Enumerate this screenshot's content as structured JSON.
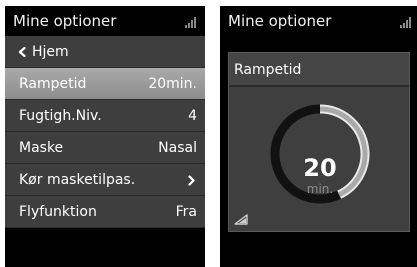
{
  "left_screen": {
    "title": "Mine optioner",
    "menu": [
      {
        "label": "Hjem",
        "value": "",
        "icon": "back-arrow-icon"
      },
      {
        "label": "Rampetid",
        "value": "20min.",
        "selected": true
      },
      {
        "label": "Fugtigh.Niv.",
        "value": "4"
      },
      {
        "label": "Maske",
        "value": "Nasal"
      },
      {
        "label": "Kør masketilpas.",
        "value": "",
        "icon": "chevron-right-icon"
      },
      {
        "label": "Flyfunktion",
        "value": "Fra"
      }
    ]
  },
  "right_screen": {
    "title": "Mine optioner",
    "panel_title": "Rampetid",
    "ramp_value": "20",
    "ramp_unit": "min.",
    "ramp_progress_fraction": 0.43
  },
  "colors": {
    "screen_bg": "#000000",
    "item_bg": "#3e3e3e",
    "selected_bg": "#9c9c9c",
    "text": "#ffffff",
    "dial_track": "#111111",
    "dial_progress": "#b3b3b3"
  }
}
